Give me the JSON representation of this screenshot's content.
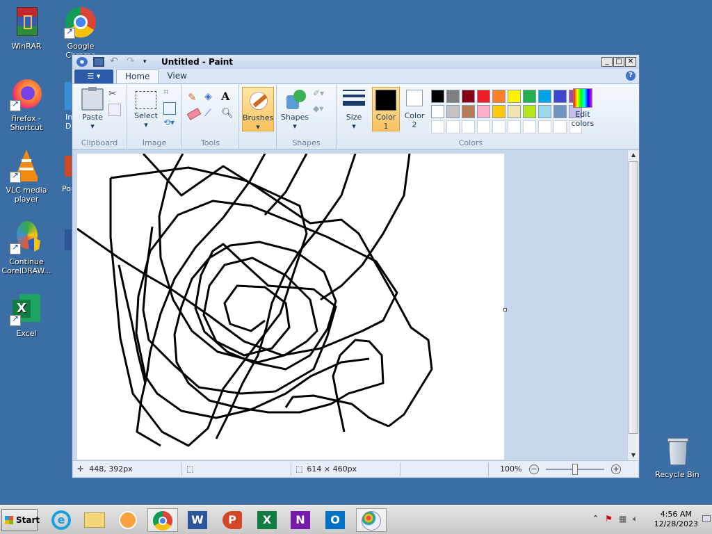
{
  "desktop": {
    "icons": [
      {
        "label": "WinRAR",
        "icon": "winrar-icon"
      },
      {
        "label": "Google Chrome",
        "icon": "chrome-icon"
      },
      {
        "label": "firefox - Shortcut",
        "icon": "firefox-icon"
      },
      {
        "label": "VLC media player",
        "icon": "vlc-icon"
      },
      {
        "label": "Continue CorelDRAW...",
        "icon": "coreldraw-icon"
      },
      {
        "label": "Excel",
        "icon": "excel-icon"
      },
      {
        "label": "Recycle Bin",
        "icon": "recycle-bin-icon"
      }
    ],
    "partial_labels": [
      "In",
      "Do",
      "Po"
    ]
  },
  "paint": {
    "title": "Untitled - Paint",
    "tabs": [
      "Home",
      "View"
    ],
    "groups": {
      "clipboard": {
        "label": "Clipboard",
        "paste": "Paste"
      },
      "image": {
        "label": "Image",
        "select": "Select"
      },
      "tools": {
        "label": "Tools"
      },
      "brushes": {
        "label": "Brushes"
      },
      "shapes": {
        "label": "Shapes",
        "shapes_btn": "Shapes"
      },
      "size": {
        "label": "Size"
      },
      "colors": {
        "label": "Colors",
        "color1": "Color 1",
        "color2": "Color 2",
        "edit": "Edit colors"
      }
    },
    "palette": [
      "#000000",
      "#7f7f7f",
      "#880015",
      "#ed1c24",
      "#ff7f27",
      "#fff200",
      "#22b14c",
      "#00a2e8",
      "#3f48cc",
      "#a349a4",
      "#ffffff",
      "#c3c3c3",
      "#b97a57",
      "#ffaec9",
      "#ffc90e",
      "#efe4b0",
      "#b5e61d",
      "#99d9ea",
      "#7092be",
      "#c8bfe7"
    ],
    "color1_value": "#000000",
    "color2_value": "#ffffff",
    "status": {
      "cursor_pos": "448, 392px",
      "canvas_size": "614 × 460px",
      "zoom": "100%"
    }
  },
  "taskbar": {
    "start_label": "Start",
    "apps": [
      "internet-explorer-icon",
      "file-explorer-icon",
      "media-player-icon",
      "chrome-icon",
      "word-icon",
      "powerpoint-icon",
      "excel-icon",
      "onenote-icon",
      "outlook-icon",
      "paint-icon"
    ],
    "time": "4:56 AM",
    "date": "12/28/2023"
  }
}
